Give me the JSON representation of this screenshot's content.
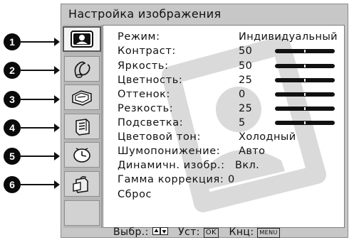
{
  "menu": {
    "title": "Настройка изображения",
    "badges": [
      "1",
      "2",
      "3",
      "4",
      "5",
      "6"
    ],
    "tabs": [
      {
        "icon": "picture-icon",
        "active": true
      },
      {
        "icon": "sound-icon",
        "active": false
      },
      {
        "icon": "screen-icon",
        "active": false
      },
      {
        "icon": "setup-icon",
        "active": false
      },
      {
        "icon": "timer-icon",
        "active": false
      },
      {
        "icon": "pc-icon",
        "active": false
      },
      {
        "icon": "",
        "active": false
      }
    ]
  },
  "settings": [
    {
      "label": "Режим:",
      "value": "Индивидуальный"
    },
    {
      "label": "Контраст:",
      "value": "50",
      "slider": 0.5
    },
    {
      "label": "Яркость:",
      "value": "50",
      "slider": 0.5
    },
    {
      "label": "Цветность:",
      "value": "25",
      "slider": 0.5
    },
    {
      "label": "Оттенок:",
      "value": "0",
      "slider": 0.5
    },
    {
      "label": "Резкость:",
      "value": "25",
      "slider": 0.5
    },
    {
      "label": "Подсветка:",
      "value": "5",
      "slider": 0.5
    },
    {
      "label": "Цветовой тон:",
      "value": "Холодный"
    },
    {
      "label": "Шумопонижение:",
      "value": "Авто"
    },
    {
      "label": "Динамичн. изобр.:",
      "value": "Вкл."
    },
    {
      "label": "Гамма коррекция:",
      "value": "0"
    },
    {
      "label": "Сброс",
      "value": ""
    }
  ],
  "footer": {
    "select_label": "Выбр.:",
    "set_label": "Уст:",
    "set_key": "OK",
    "exit_label": "Кнц:",
    "exit_key": "MENU"
  },
  "colors": {
    "panel": "#c7c7c7",
    "content": "#ffffff",
    "badge": "#0a0a0a",
    "bar": "#111111",
    "watermark": "#dadada"
  }
}
